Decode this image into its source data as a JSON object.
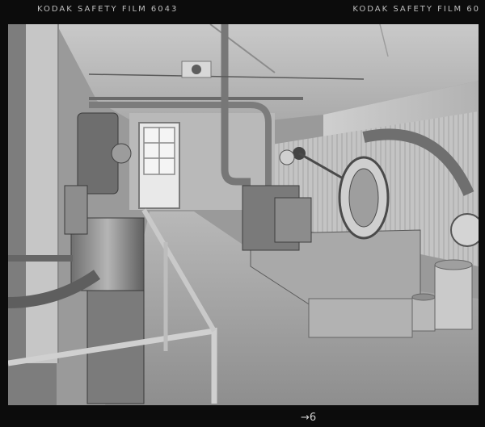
{
  "film_edge": {
    "left_text": "KODAK   SAFETY   FILM   6043",
    "right_text": "KODAK   SAFETY   FILM   60",
    "frame_number": "→6"
  },
  "photo": {
    "subject": "engine room interior",
    "tone": "black-and-white"
  },
  "colors": {
    "film_border": "#0c0c0c",
    "edge_print": "#bdbdbd"
  }
}
